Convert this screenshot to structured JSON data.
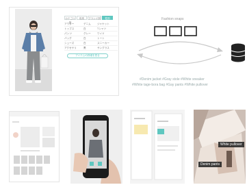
{
  "table_panel": {
    "tabs": [
      "カテゴリ別",
      "色別",
      "ブランド別",
      "性別"
    ],
    "active_tab_index": 3,
    "rows": [
      [
        "アウター",
        "デニム",
        "ジャケット"
      ],
      [
        "トップス",
        "白",
        "Tシャツ"
      ],
      [
        "パンツ",
        "グレー",
        "ワイド"
      ],
      [
        "バッグ",
        "白",
        "トート"
      ],
      [
        "シューズ",
        "白",
        "スニーカー"
      ],
      [
        "アクセサリ",
        "黒",
        "サングラス"
      ]
    ],
    "button_label": "アイテムの詳細を見る"
  },
  "diagram": {
    "title": "Fashion snaps",
    "hashtags_line1": "#Denim jacket  #Gray stole  #White sneaker",
    "hashtags_line2": "#White tage-bora bag  #Gay pants  #White pullover"
  },
  "overlay_labels": {
    "top": "White pullover",
    "bottom": "Denim pants"
  },
  "colors": {
    "accent": "#5fc7c0",
    "database": "#222222",
    "arrow": "#c8c8c8"
  }
}
